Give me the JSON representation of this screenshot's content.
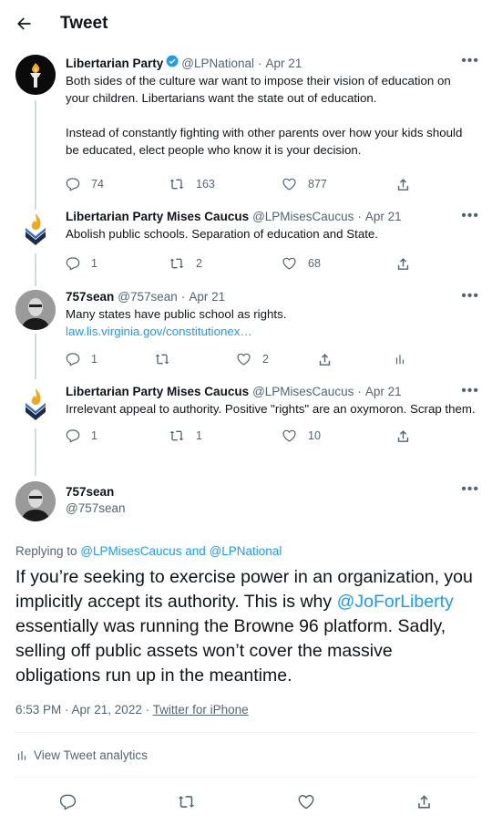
{
  "header": {
    "title": "Tweet"
  },
  "tweets": [
    {
      "name": "Libertarian Party",
      "handle": "@LPNational",
      "date": "Apr 21",
      "text1": "Both sides of the culture war want to impose their vision of education on your children. Libertarians want the state out of education.",
      "text2": "Instead of constantly fighting with other parents over how your kids should be educated, elect people who know it is your decision.",
      "replies": "74",
      "retweets": "163",
      "likes": "877"
    },
    {
      "name": "Libertarian Party Mises Caucus",
      "handle": "@LPMisesCaucus",
      "date": "Apr 21",
      "text1": "Abolish public schools. Separation of education and State.",
      "replies": "1",
      "retweets": "2",
      "likes": "68"
    },
    {
      "name": "757sean",
      "handle": "@757sean",
      "date": "Apr 21",
      "text1": "Many states have public school as rights.",
      "link": "law.lis.virginia.gov/constitutionex…",
      "replies": "1",
      "retweets": "",
      "likes": "2"
    },
    {
      "name": "Libertarian Party Mises Caucus",
      "handle": "@LPMisesCaucus",
      "date": "Apr 21",
      "text1": "Irrelevant appeal to authority. Positive \"rights\" are an oxymoron. Scrap them.",
      "replies": "1",
      "retweets": "1",
      "likes": "10"
    }
  ],
  "main": {
    "name": "757sean",
    "handle": "@757sean",
    "replying_prefix": "Replying to ",
    "replying_to": "@LPMisesCaucus and @LPNational",
    "text_a": "If you’re seeking to exercise power in an organization, you implicitly accept its authority. This is why ",
    "mention": "@JoForLiberty",
    "text_b": " essentially was running the Browne 96 platform. Sadly, selling off public assets won’t cover the massive obligations run up in the meantime.",
    "timestamp": "6:53 PM · Apr 21, 2022 · ",
    "source": "Twitter for iPhone",
    "analytics": "View Tweet analytics"
  },
  "colors": {
    "accent": "#1d9bf0",
    "secondary": "#536471",
    "border": "#eff3f4"
  }
}
